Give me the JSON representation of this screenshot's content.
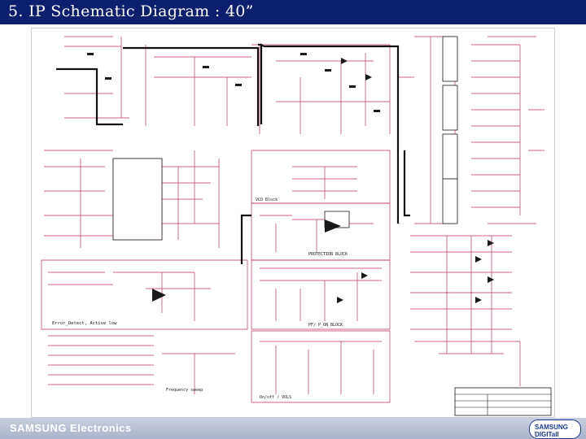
{
  "slide": {
    "title": "5. IP Schematic Diagram : 40”"
  },
  "footer": {
    "brand": "SAMSUNG Electronics",
    "logo": "SAMSUNG DIGITall"
  },
  "blocks": {
    "vco": "VCO Block",
    "protection": "PROTECTION BLOCK",
    "error": "Error_Detect, Active low",
    "pf": "PF/ P_ON BLOCK",
    "freq": "Frequency sweep",
    "onoff": "On/off / VOLS"
  },
  "colors": {
    "title_bg": "#0a1f6e",
    "wire": "#c0305a",
    "parts": "#1a1a1a"
  }
}
